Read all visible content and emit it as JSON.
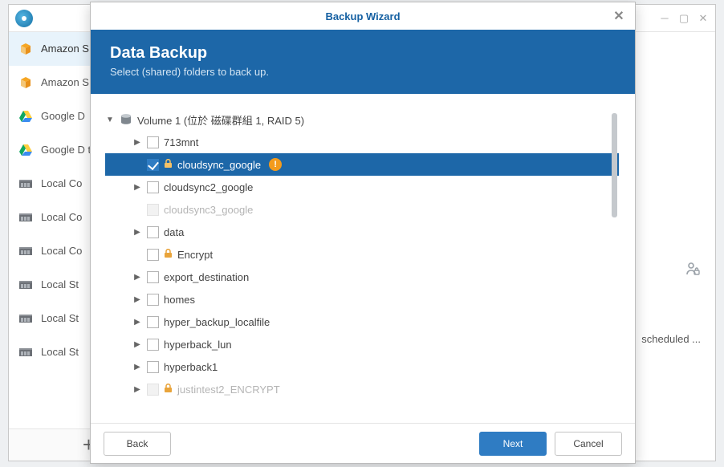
{
  "background": {
    "title": "",
    "window_controls": [
      "min",
      "max",
      "close"
    ],
    "right_pane_hint": "scheduled ..."
  },
  "sidebar": {
    "items": [
      {
        "icon": "amazon-s3",
        "label": "Amazon S"
      },
      {
        "icon": "amazon-s3",
        "label": "Amazon S"
      },
      {
        "icon": "google-drive",
        "label": "Google D"
      },
      {
        "icon": "google-drive",
        "label": "Google D test"
      },
      {
        "icon": "local",
        "label": "Local Co"
      },
      {
        "icon": "local",
        "label": "Local Co"
      },
      {
        "icon": "local",
        "label": "Local Co"
      },
      {
        "icon": "local",
        "label": "Local St"
      },
      {
        "icon": "local",
        "label": "Local St"
      },
      {
        "icon": "local",
        "label": "Local St"
      }
    ],
    "add_label": "+"
  },
  "modal": {
    "title": "Backup Wizard",
    "header_title": "Data Backup",
    "header_sub": "Select (shared) folders to back up.",
    "volume_label": "Volume 1 (位於 磁碟群組 1, RAID 5)",
    "nodes": [
      {
        "label": "713mnt",
        "indent": 1,
        "expandable": true,
        "checked": false,
        "disabled": false
      },
      {
        "label": "cloudsync_google",
        "indent": 1,
        "expandable": false,
        "checked": true,
        "disabled": false,
        "locked": true,
        "warn": true,
        "selected": true
      },
      {
        "label": "cloudsync2_google",
        "indent": 1,
        "expandable": true,
        "checked": false,
        "disabled": false
      },
      {
        "label": "cloudsync3_google",
        "indent": 1,
        "expandable": false,
        "checked": false,
        "disabled": true
      },
      {
        "label": "data",
        "indent": 1,
        "expandable": true,
        "checked": false,
        "disabled": false
      },
      {
        "label": "Encrypt",
        "indent": 1,
        "expandable": false,
        "checked": false,
        "disabled": false,
        "locked": true
      },
      {
        "label": "export_destination",
        "indent": 1,
        "expandable": true,
        "checked": false,
        "disabled": false
      },
      {
        "label": "homes",
        "indent": 1,
        "expandable": true,
        "checked": false,
        "disabled": false
      },
      {
        "label": "hyper_backup_localfile",
        "indent": 1,
        "expandable": true,
        "checked": false,
        "disabled": false
      },
      {
        "label": "hyperback_lun",
        "indent": 1,
        "expandable": true,
        "checked": false,
        "disabled": false
      },
      {
        "label": "hyperback1",
        "indent": 1,
        "expandable": true,
        "checked": false,
        "disabled": false
      },
      {
        "label": "justintest2_ENCRYPT",
        "indent": 1,
        "expandable": true,
        "checked": false,
        "disabled": true,
        "locked": true
      }
    ],
    "buttons": {
      "back": "Back",
      "next": "Next",
      "cancel": "Cancel"
    }
  }
}
